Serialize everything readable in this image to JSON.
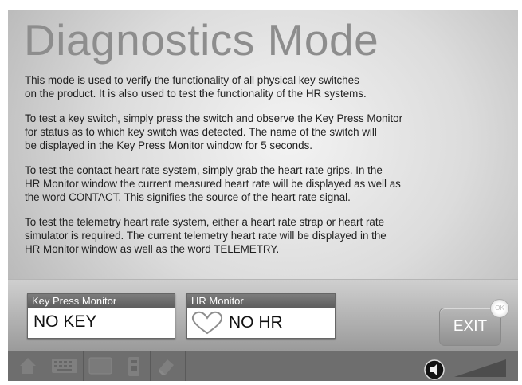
{
  "title": "Diagnostics Mode",
  "paragraphs": [
    "This mode is used to verify the functionality of all physical key switches\non the product.  It is also used to test the functionality of the HR systems.",
    "To test a key switch, simply press the switch and observe the Key Press Monitor\nfor status as to which key switch was detected.  The name of the switch will\nbe displayed in the Key Press Monitor window for 5 seconds.",
    "To test the contact heart rate system, simply grab the heart rate grips.  In the\nHR Monitor window the current measured heart rate will be displayed as well as\nthe word CONTACT.  This signifies the source of the heart rate signal.",
    "To test the telemetry heart rate system, either a heart rate strap or heart rate\nsimulator is required.  The current telemetry heart rate will be displayed in the\nHR Monitor window as well as the word TELEMETRY."
  ],
  "key_press_monitor": {
    "label": "Key Press Monitor",
    "value": "NO KEY"
  },
  "hr_monitor": {
    "label": "HR Monitor",
    "value": "NO HR"
  },
  "exit_label": "EXIT",
  "bottom_bar": {
    "icons": [
      "home-icon",
      "keyboard-icon",
      "tv-icon",
      "remote-icon",
      "eraser-icon"
    ],
    "volume_icon": "speaker-icon"
  }
}
